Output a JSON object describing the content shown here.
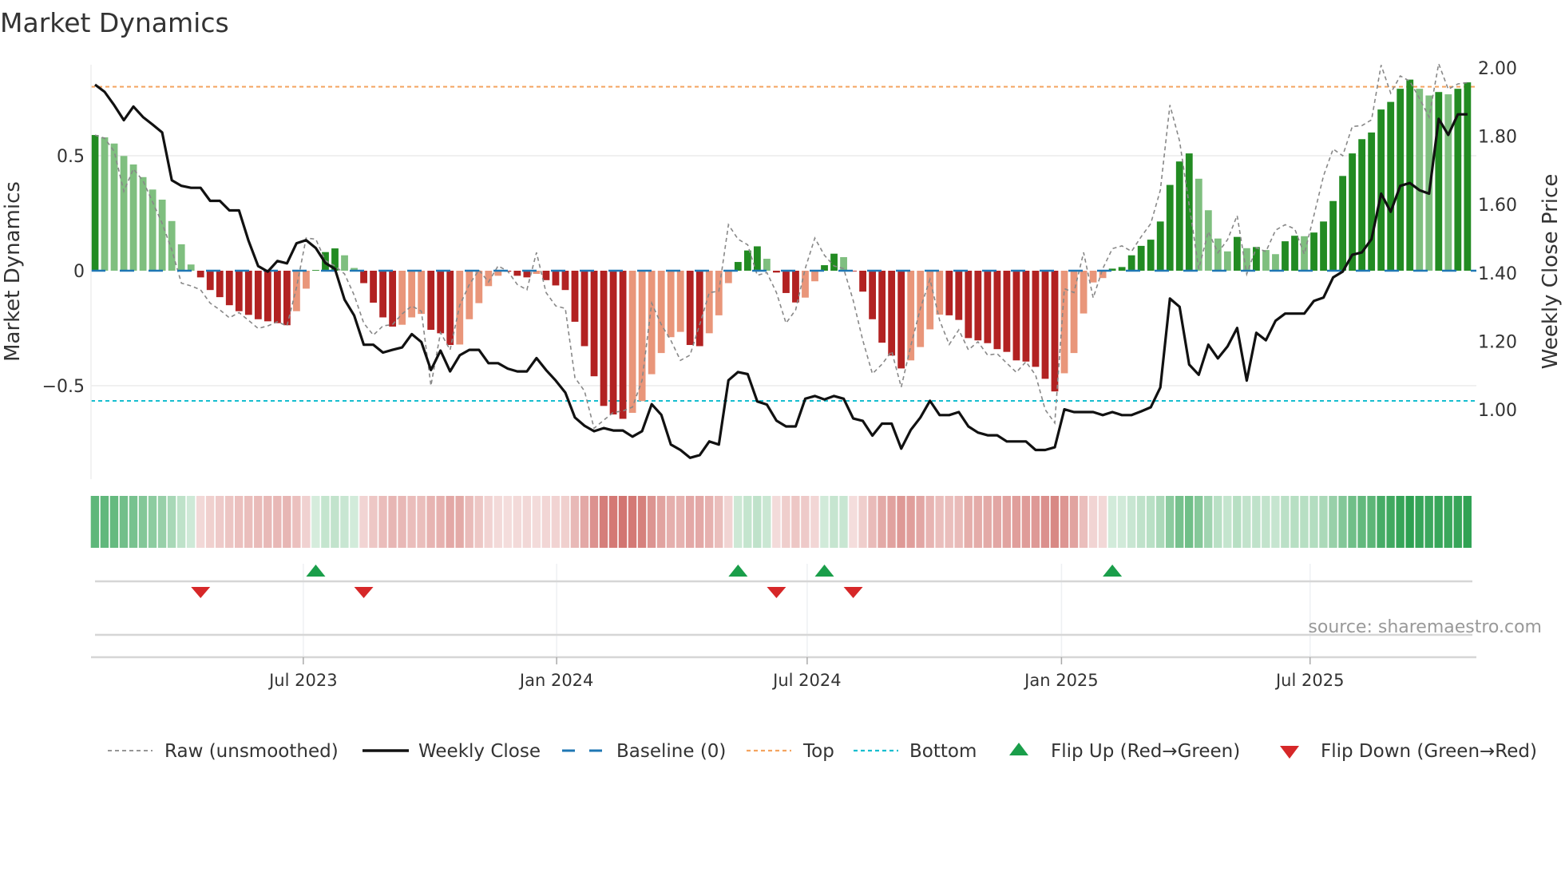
{
  "title": "Market Dynamics",
  "source": "source: sharemaestro.com",
  "colors": {
    "bar_pos_strong": "#228b22",
    "bar_pos_weak": "#7fbf7f",
    "bar_neg_strong": "#b22222",
    "bar_neg_weak": "#e9967a",
    "raw": "#888888",
    "close": "#111111",
    "baseline": "#1f77b4",
    "top": "#f4a460",
    "bottom": "#17becf",
    "flip_up": "#1a9e4a",
    "flip_down": "#d62728",
    "heat_pos": "44,160,80",
    "heat_neg": "200,85,80"
  },
  "legend": [
    {
      "key": "raw",
      "label": "Raw (unsmoothed)"
    },
    {
      "key": "close",
      "label": "Weekly Close"
    },
    {
      "key": "baseline",
      "label": "Baseline (0)"
    },
    {
      "key": "top",
      "label": "Top"
    },
    {
      "key": "bottom",
      "label": "Bottom"
    },
    {
      "key": "flip_up",
      "label": "Flip Up (Red→Green)"
    },
    {
      "key": "flip_down",
      "label": "Flip Down (Green→Red)"
    }
  ],
  "chart_data": {
    "type": "bar",
    "title": "Market Dynamics",
    "xlabel": "",
    "ylabel": "Market Dynamics",
    "ylabel_right": "Weekly Close Price",
    "x_unit": "week index",
    "ylim": [
      -0.906,
      0.896
    ],
    "ylim_right": [
      0.797,
      2.007
    ],
    "yticks": [
      {
        "v": 0.5,
        "label": "0.5"
      },
      {
        "v": 0,
        "label": "0"
      },
      {
        "v": -0.5,
        "label": "−0.5"
      }
    ],
    "yticks_right": [
      {
        "v": 2.0,
        "label": "2.00"
      },
      {
        "v": 1.8,
        "label": "1.80"
      },
      {
        "v": 1.6,
        "label": "1.60"
      },
      {
        "v": 1.4,
        "label": "1.40"
      },
      {
        "v": 1.2,
        "label": "1.20"
      },
      {
        "v": 1.0,
        "label": "1.00"
      }
    ],
    "xticks": [
      {
        "v": 21.7,
        "label": "Jul 2023"
      },
      {
        "v": 48.1,
        "label": "Jan 2024"
      },
      {
        "v": 74.2,
        "label": "Jul 2024"
      },
      {
        "v": 100.7,
        "label": "Jan 2025"
      },
      {
        "v": 126.6,
        "label": "Jul 2025"
      }
    ],
    "baseline": 0,
    "top": 0.8,
    "bottom": -0.566,
    "grid": true,
    "legend_position": "bottom",
    "momentum": [
      0.59,
      0.58,
      0.553,
      0.499,
      0.462,
      0.407,
      0.353,
      0.309,
      0.216,
      0.115,
      0.027,
      -0.029,
      -0.084,
      -0.115,
      -0.15,
      -0.176,
      -0.192,
      -0.211,
      -0.22,
      -0.228,
      -0.237,
      -0.176,
      -0.078,
      0.003,
      0.081,
      0.097,
      0.067,
      0.012,
      -0.054,
      -0.139,
      -0.203,
      -0.243,
      -0.235,
      -0.203,
      -0.188,
      -0.257,
      -0.272,
      -0.323,
      -0.321,
      -0.211,
      -0.141,
      -0.067,
      -0.022,
      -0.004,
      -0.022,
      -0.029,
      -0.014,
      -0.041,
      -0.064,
      -0.084,
      -0.222,
      -0.328,
      -0.459,
      -0.588,
      -0.625,
      -0.644,
      -0.618,
      -0.567,
      -0.45,
      -0.358,
      -0.289,
      -0.266,
      -0.323,
      -0.328,
      -0.272,
      -0.194,
      -0.054,
      0.038,
      0.088,
      0.106,
      0.052,
      -0.008,
      -0.097,
      -0.138,
      -0.117,
      -0.046,
      0.024,
      0.074,
      0.059,
      -0.003,
      -0.091,
      -0.211,
      -0.313,
      -0.369,
      -0.425,
      -0.39,
      -0.332,
      -0.255,
      -0.191,
      -0.194,
      -0.214,
      -0.293,
      -0.303,
      -0.315,
      -0.341,
      -0.353,
      -0.39,
      -0.395,
      -0.418,
      -0.47,
      -0.525,
      -0.446,
      -0.358,
      -0.186,
      -0.051,
      -0.032,
      0.009,
      0.016,
      0.067,
      0.108,
      0.135,
      0.214,
      0.373,
      0.475,
      0.51,
      0.4,
      0.263,
      0.14,
      0.084,
      0.147,
      0.098,
      0.103,
      0.09,
      0.072,
      0.128,
      0.152,
      0.15,
      0.166,
      0.214,
      0.303,
      0.412,
      0.51,
      0.572,
      0.601,
      0.701,
      0.734,
      0.791,
      0.831,
      0.791,
      0.762,
      0.777,
      0.767,
      0.791,
      0.819
    ],
    "strengthening": [
      1,
      0,
      0,
      0,
      0,
      0,
      0,
      0,
      0,
      0,
      0,
      1,
      1,
      1,
      1,
      1,
      1,
      1,
      1,
      1,
      1,
      0,
      0,
      1,
      1,
      1,
      0,
      0,
      1,
      1,
      1,
      1,
      0,
      0,
      0,
      1,
      1,
      1,
      0,
      0,
      0,
      0,
      0,
      1,
      1,
      1,
      0,
      1,
      1,
      1,
      1,
      1,
      1,
      1,
      1,
      1,
      0,
      0,
      0,
      0,
      0,
      0,
      1,
      1,
      0,
      0,
      0,
      1,
      1,
      1,
      0,
      1,
      1,
      1,
      0,
      0,
      1,
      1,
      0,
      1,
      1,
      1,
      1,
      1,
      1,
      0,
      0,
      0,
      0,
      1,
      1,
      1,
      1,
      1,
      1,
      1,
      1,
      1,
      1,
      1,
      1,
      0,
      0,
      0,
      0,
      0,
      1,
      1,
      1,
      1,
      1,
      1,
      1,
      1,
      1,
      0,
      0,
      0,
      0,
      1,
      0,
      1,
      0,
      0,
      1,
      1,
      0,
      1,
      1,
      1,
      1,
      1,
      1,
      1,
      1,
      1,
      1,
      1,
      0,
      0,
      1,
      0,
      1,
      1
    ],
    "raw": [
      0.59,
      0.576,
      0.519,
      0.345,
      0.443,
      0.391,
      0.299,
      0.206,
      0.09,
      -0.054,
      -0.066,
      -0.083,
      -0.141,
      -0.17,
      -0.205,
      -0.182,
      -0.216,
      -0.251,
      -0.24,
      -0.222,
      -0.24,
      -0.072,
      0.142,
      0.137,
      0.044,
      0.021,
      -0.014,
      -0.106,
      -0.228,
      -0.28,
      -0.24,
      -0.234,
      -0.188,
      -0.153,
      -0.176,
      -0.5,
      -0.269,
      -0.344,
      -0.15,
      -0.06,
      0.003,
      -0.049,
      0.021,
      -0.002,
      -0.06,
      -0.083,
      0.079,
      -0.095,
      -0.153,
      -0.164,
      -0.465,
      -0.523,
      -0.685,
      -0.65,
      -0.616,
      -0.61,
      -0.593,
      -0.477,
      -0.141,
      -0.234,
      -0.303,
      -0.39,
      -0.367,
      -0.234,
      -0.095,
      -0.089,
      0.2,
      0.137,
      0.113,
      -0.02,
      -0.008,
      -0.095,
      -0.228,
      -0.17,
      0.01,
      0.142,
      0.067,
      0.021,
      0.009,
      -0.13,
      -0.303,
      -0.448,
      -0.407,
      -0.35,
      -0.506,
      -0.326,
      -0.164,
      -0.037,
      -0.216,
      -0.321,
      -0.257,
      -0.344,
      -0.309,
      -0.367,
      -0.361,
      -0.402,
      -0.442,
      -0.396,
      -0.454,
      -0.604,
      -0.662,
      -0.078,
      -0.095,
      0.079,
      -0.118,
      0.009,
      0.096,
      0.108,
      0.084,
      0.148,
      0.205,
      0.35,
      0.72,
      0.564,
      0.286,
      0.008,
      0.17,
      0.078,
      0.135,
      0.24,
      -0.015,
      0.1,
      0.083,
      0.176,
      0.2,
      0.182,
      0.072,
      0.24,
      0.413,
      0.529,
      0.5,
      0.627,
      0.631,
      0.656,
      0.894,
      0.772,
      0.847,
      0.824,
      0.749,
      0.668,
      0.9,
      0.789,
      0.812,
      0.818
    ],
    "weekly_close": [
      1.951,
      1.93,
      1.891,
      1.847,
      1.887,
      1.856,
      1.834,
      1.811,
      1.671,
      1.655,
      1.649,
      1.649,
      1.611,
      1.611,
      1.583,
      1.583,
      1.494,
      1.42,
      1.404,
      1.435,
      1.428,
      1.487,
      1.496,
      1.473,
      1.429,
      1.412,
      1.322,
      1.276,
      1.19,
      1.19,
      1.167,
      1.175,
      1.182,
      1.221,
      1.198,
      1.116,
      1.173,
      1.112,
      1.159,
      1.175,
      1.175,
      1.136,
      1.136,
      1.12,
      1.112,
      1.112,
      1.151,
      1.116,
      1.085,
      1.05,
      0.977,
      0.953,
      0.937,
      0.946,
      0.939,
      0.939,
      0.921,
      0.937,
      1.016,
      0.985,
      0.898,
      0.882,
      0.859,
      0.867,
      0.907,
      0.898,
      1.086,
      1.11,
      1.104,
      1.024,
      1.015,
      0.968,
      0.951,
      0.951,
      1.032,
      1.04,
      1.03,
      1.04,
      1.032,
      0.974,
      0.967,
      0.924,
      0.959,
      0.959,
      0.886,
      0.941,
      0.977,
      1.026,
      0.984,
      0.984,
      0.993,
      0.951,
      0.933,
      0.925,
      0.925,
      0.907,
      0.907,
      0.907,
      0.882,
      0.882,
      0.89,
      1.001,
      0.993,
      0.993,
      0.993,
      0.984,
      0.993,
      0.984,
      0.984,
      0.995,
      1.007,
      1.065,
      1.325,
      1.301,
      1.132,
      1.102,
      1.19,
      1.15,
      1.185,
      1.239,
      1.085,
      1.225,
      1.203,
      1.26,
      1.281,
      1.281,
      1.281,
      1.318,
      1.328,
      1.387,
      1.404,
      1.453,
      1.46,
      1.499,
      1.632,
      1.579,
      1.655,
      1.663,
      1.642,
      1.632,
      1.851,
      1.804,
      1.864,
      1.864
    ],
    "flip_up": [
      23,
      67,
      76,
      106
    ],
    "flip_down": [
      11,
      28,
      71,
      79
    ]
  }
}
